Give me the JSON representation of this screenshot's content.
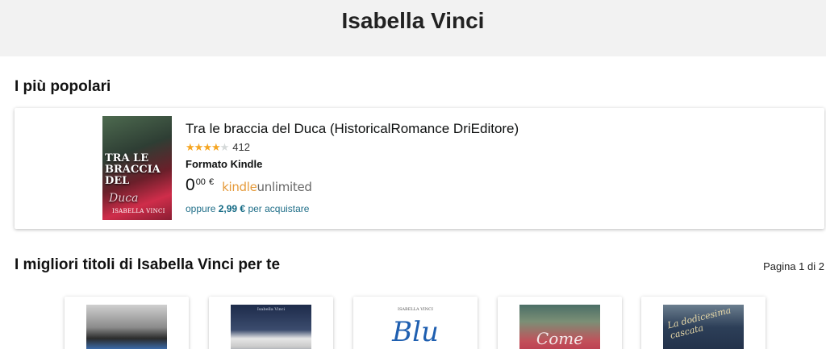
{
  "header": {
    "title": "Isabella Vinci"
  },
  "popular": {
    "section_title": "I più popolari",
    "book": {
      "title": "Tra le braccia del Duca (HistoricalRomance DriEditore)",
      "rating_value": 4.5,
      "rating_max": 5,
      "review_count": "412",
      "format": "Formato Kindle",
      "price_int": "0",
      "price_dec": "00",
      "currency": "€",
      "kindle_word": "kindle",
      "unlimited_word": "unlimited",
      "alt_prefix": "oppure",
      "alt_price": "2,99 €",
      "alt_suffix": "per acquistare",
      "cover": {
        "title_line1": "TRA LE",
        "title_line2": "BRACCIA",
        "title_line3": "DEL",
        "title_script": "Duca",
        "author": "ISABELLA VINCI"
      }
    }
  },
  "best": {
    "section_title": "I migliori titoli di Isabella Vinci per te",
    "pagination": "Pagina 1 di 2",
    "items": [
      {
        "cover_text": ""
      },
      {
        "cover_author": "Isabella Vinci"
      },
      {
        "cover_author": "ISABELLA VINCI",
        "cover_text": "Blu"
      },
      {
        "cover_text": "Come"
      },
      {
        "cover_text": "La dodicesima cascata"
      }
    ]
  },
  "colors": {
    "header_bg": "#f2f2f2",
    "link": "#1f6e88",
    "star": "#f5a623",
    "kindle_orange": "#e59a3a"
  }
}
